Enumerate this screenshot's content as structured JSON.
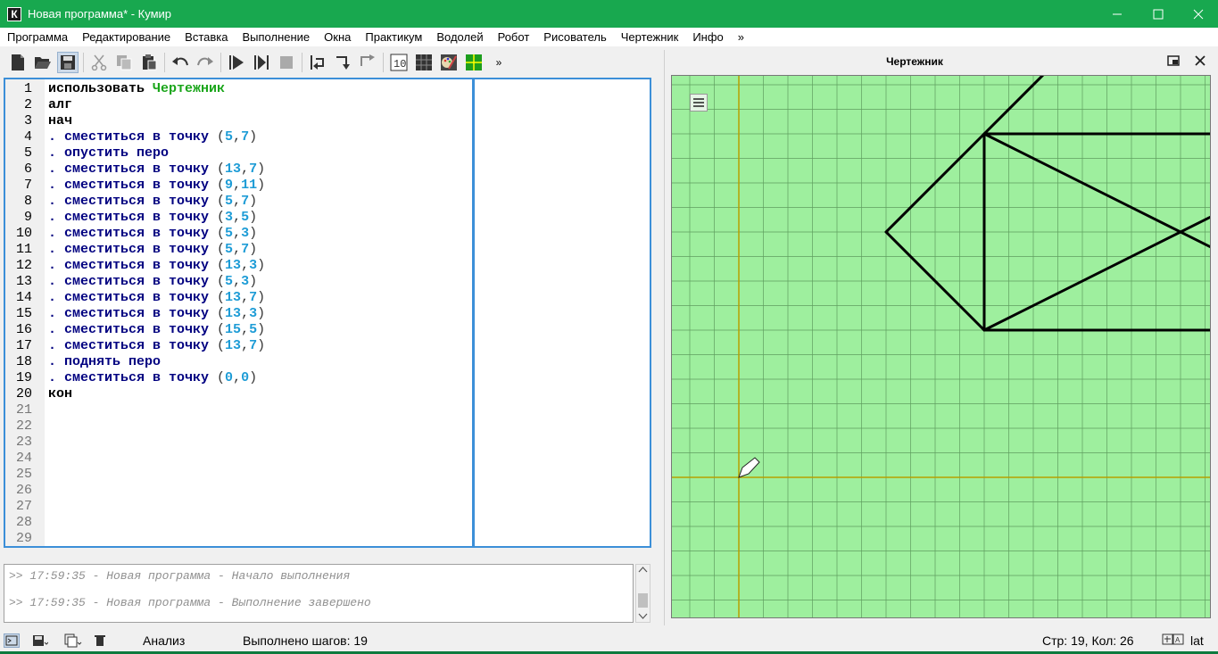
{
  "window": {
    "title": "Новая программа* - Кумир",
    "app_icon": "К"
  },
  "menu": [
    "Программа",
    "Редактирование",
    "Вставка",
    "Выполнение",
    "Окна",
    "Практикум",
    "Водолей",
    "Робот",
    "Рисователь",
    "Чертежник",
    "Инфо",
    "»"
  ],
  "toolbar": {
    "overflow": "»"
  },
  "editor": {
    "line_numbers": [
      "1",
      "2",
      "3",
      "4",
      "5",
      "6",
      "7",
      "8",
      "9",
      "10",
      "11",
      "12",
      "13",
      "14",
      "15",
      "16",
      "17",
      "18",
      "19",
      "20",
      "21",
      "22",
      "23",
      "24",
      "25",
      "26",
      "27",
      "28",
      "29"
    ],
    "line1_kw": "использовать",
    "line1_mod": "Чертежник",
    "line2": "алг",
    "line3": "нач",
    "line4_cmd": ". сместиться в точку ",
    "line4_a": "5",
    "line4_b": "7",
    "line5": ". опустить перо",
    "line6_cmd": ". сместиться в точку ",
    "line6_a": "13",
    "line6_b": "7",
    "line7_cmd": ". сместиться в точку ",
    "line7_a": "9",
    "line7_b": "11",
    "line8_cmd": ". сместиться в точку ",
    "line8_a": "5",
    "line8_b": "7",
    "line9_cmd": ". сместиться в точку ",
    "line9_a": "3",
    "line9_b": "5",
    "line10_cmd": ". сместиться в точку ",
    "line10_a": "5",
    "line10_b": "3",
    "line11_cmd": ". сместиться в точку ",
    "line11_a": "5",
    "line11_b": "7",
    "line12_cmd": ". сместиться в точку ",
    "line12_a": "13",
    "line12_b": "3",
    "line13_cmd": ". сместиться в точку ",
    "line13_a": "5",
    "line13_b": "3",
    "line14_cmd": ". сместиться в точку ",
    "line14_a": "13",
    "line14_b": "7",
    "line15_cmd": ". сместиться в точку ",
    "line15_a": "13",
    "line15_b": "3",
    "line16_cmd": ". сместиться в точку ",
    "line16_a": "15",
    "line16_b": "5",
    "line17_cmd": ". сместиться в точку ",
    "line17_a": "13",
    "line17_b": "7",
    "line18": ". поднять перо",
    "line19_cmd": ". сместиться в точку ",
    "line19_a": "0",
    "line19_b": "0",
    "line20": "кон"
  },
  "console": {
    "log1": ">> 17:59:35 - Новая программа - Начало выполнения",
    "log2": ">> 17:59:35 - Новая программа - Выполнение завершено"
  },
  "status": {
    "analysis": "Анализ",
    "steps": "Выполнено шагов: 19",
    "position": "Стр: 19, Кол: 26",
    "layout": "lat"
  },
  "drawer": {
    "title": "Чертежник",
    "background": "#9eef9e",
    "segments": [
      [
        5,
        7,
        13,
        7
      ],
      [
        13,
        7,
        9,
        11
      ],
      [
        9,
        11,
        5,
        7
      ],
      [
        5,
        7,
        3,
        5
      ],
      [
        3,
        5,
        5,
        3
      ],
      [
        5,
        3,
        5,
        7
      ],
      [
        5,
        7,
        13,
        3
      ],
      [
        13,
        3,
        5,
        3
      ],
      [
        5,
        3,
        13,
        7
      ],
      [
        13,
        7,
        13,
        3
      ],
      [
        13,
        3,
        15,
        5
      ],
      [
        15,
        5,
        13,
        7
      ]
    ],
    "pen_position": [
      0,
      0
    ]
  }
}
